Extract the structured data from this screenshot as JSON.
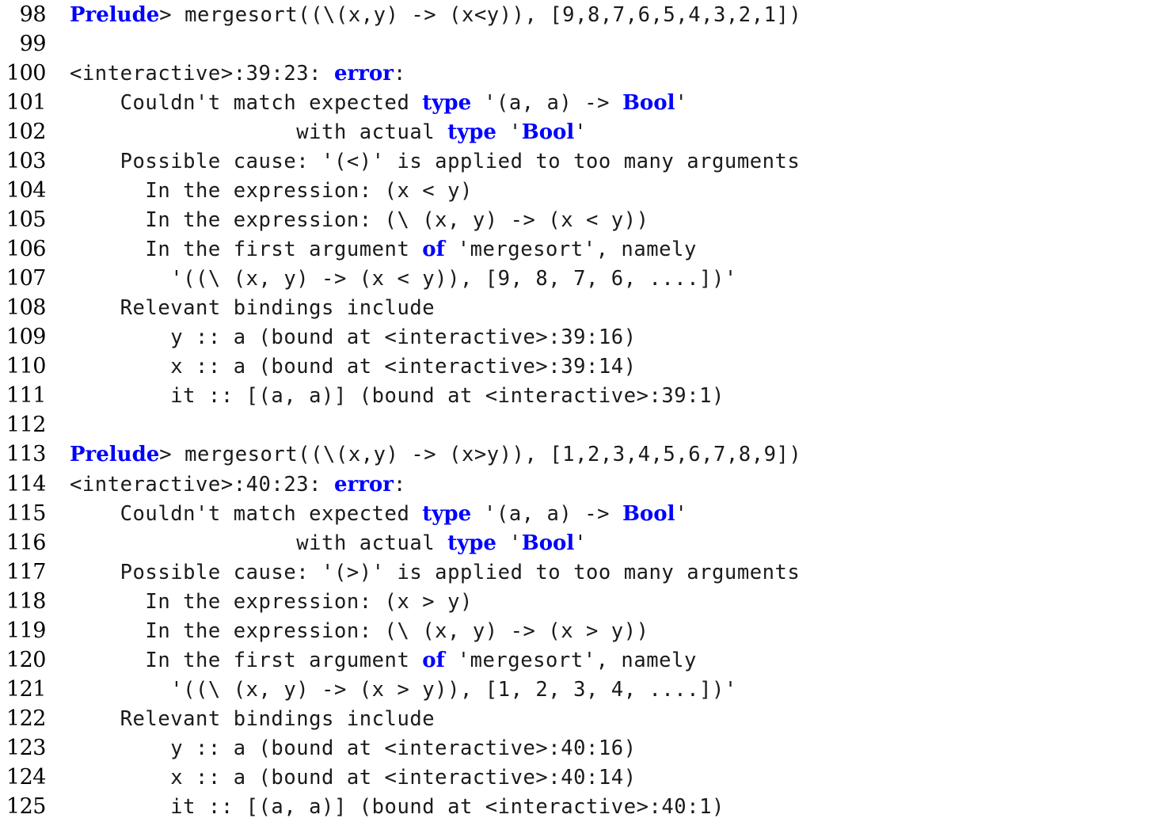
{
  "document": {
    "kind": "code-listing",
    "language": "Haskell GHCi session",
    "background_color": "#ffffff",
    "text_color": "#1a1a1a",
    "keyword_color": "#0000ff",
    "line_number_color": "#000000",
    "first_line_number": 98,
    "last_line_number": 125
  },
  "lines": [
    {
      "number": "98",
      "text": "Prelude> mergesort((\\(x,y) -> (x<y)), [9,8,7,6,5,4,3,2,1])",
      "tokens": [
        {
          "t": "Prelude",
          "kw": true
        },
        {
          "t": "> mergesort((\\(x,y) -> (x<y)), [9,8,7,6,5,4,3,2,1])",
          "kw": false
        }
      ]
    },
    {
      "number": "99",
      "text": "",
      "tokens": [
        {
          "t": "",
          "kw": false
        }
      ]
    },
    {
      "number": "100",
      "text": "<interactive>:39:23: error:",
      "tokens": [
        {
          "t": "<interactive>:39:23: ",
          "kw": false
        },
        {
          "t": "error",
          "kw": true
        },
        {
          "t": ":",
          "kw": false
        }
      ]
    },
    {
      "number": "101",
      "text": "    Couldn't match expected type '(a, a) -> Bool'",
      "tokens": [
        {
          "t": "    Couldn't match expected ",
          "kw": false
        },
        {
          "t": "type",
          "kw": true
        },
        {
          "t": " '(a, a) -> ",
          "kw": false
        },
        {
          "t": "Bool",
          "kw": true
        },
        {
          "t": "'",
          "kw": false
        }
      ]
    },
    {
      "number": "102",
      "text": "                  with actual type 'Bool'",
      "tokens": [
        {
          "t": "                  with actual ",
          "kw": false
        },
        {
          "t": "type",
          "kw": true
        },
        {
          "t": " '",
          "kw": false
        },
        {
          "t": "Bool",
          "kw": true
        },
        {
          "t": "'",
          "kw": false
        }
      ]
    },
    {
      "number": "103",
      "text": "    Possible cause: '(<)' is applied to too many arguments",
      "tokens": [
        {
          "t": "    Possible cause: '(<)' is applied to too many arguments",
          "kw": false
        }
      ]
    },
    {
      "number": "104",
      "text": "      In the expression: (x < y)",
      "tokens": [
        {
          "t": "      In the expression: (x < y)",
          "kw": false
        }
      ]
    },
    {
      "number": "105",
      "text": "      In the expression: (\\ (x, y) -> (x < y))",
      "tokens": [
        {
          "t": "      In the expression: (\\ (x, y) -> (x < y))",
          "kw": false
        }
      ]
    },
    {
      "number": "106",
      "text": "      In the first argument of 'mergesort', namely",
      "tokens": [
        {
          "t": "      In the first argument ",
          "kw": false
        },
        {
          "t": "of",
          "kw": true
        },
        {
          "t": " 'mergesort', namely",
          "kw": false
        }
      ]
    },
    {
      "number": "107",
      "text": "        '((\\ (x, y) -> (x < y)), [9, 8, 7, 6, ....])'",
      "tokens": [
        {
          "t": "        '((\\ (x, y) -> (x < y)), [9, 8, 7, 6, ....])'",
          "kw": false
        }
      ]
    },
    {
      "number": "108",
      "text": "    Relevant bindings include",
      "tokens": [
        {
          "t": "    Relevant bindings include",
          "kw": false
        }
      ]
    },
    {
      "number": "109",
      "text": "        y :: a (bound at <interactive>:39:16)",
      "tokens": [
        {
          "t": "        y :: a (bound at <interactive>:39:16)",
          "kw": false
        }
      ]
    },
    {
      "number": "110",
      "text": "        x :: a (bound at <interactive>:39:14)",
      "tokens": [
        {
          "t": "        x :: a (bound at <interactive>:39:14)",
          "kw": false
        }
      ]
    },
    {
      "number": "111",
      "text": "        it :: [(a, a)] (bound at <interactive>:39:1)",
      "tokens": [
        {
          "t": "        it :: [(a, a)] (bound at <interactive>:39:1)",
          "kw": false
        }
      ]
    },
    {
      "number": "112",
      "text": "",
      "tokens": [
        {
          "t": "",
          "kw": false
        }
      ]
    },
    {
      "number": "113",
      "text": "Prelude> mergesort((\\(x,y) -> (x>y)), [1,2,3,4,5,6,7,8,9])",
      "tokens": [
        {
          "t": "Prelude",
          "kw": true
        },
        {
          "t": "> mergesort((\\(x,y) -> (x>y)), [1,2,3,4,5,6,7,8,9])",
          "kw": false
        }
      ]
    },
    {
      "number": "114",
      "text": "<interactive>:40:23: error:",
      "tokens": [
        {
          "t": "<interactive>:40:23: ",
          "kw": false
        },
        {
          "t": "error",
          "kw": true
        },
        {
          "t": ":",
          "kw": false
        }
      ]
    },
    {
      "number": "115",
      "text": "    Couldn't match expected type '(a, a) -> Bool'",
      "tokens": [
        {
          "t": "    Couldn't match expected ",
          "kw": false
        },
        {
          "t": "type",
          "kw": true
        },
        {
          "t": " '(a, a) -> ",
          "kw": false
        },
        {
          "t": "Bool",
          "kw": true
        },
        {
          "t": "'",
          "kw": false
        }
      ]
    },
    {
      "number": "116",
      "text": "                  with actual type 'Bool'",
      "tokens": [
        {
          "t": "                  with actual ",
          "kw": false
        },
        {
          "t": "type",
          "kw": true
        },
        {
          "t": " '",
          "kw": false
        },
        {
          "t": "Bool",
          "kw": true
        },
        {
          "t": "'",
          "kw": false
        }
      ]
    },
    {
      "number": "117",
      "text": "    Possible cause: '(>)' is applied to too many arguments",
      "tokens": [
        {
          "t": "    Possible cause: '(>)' is applied to too many arguments",
          "kw": false
        }
      ]
    },
    {
      "number": "118",
      "text": "      In the expression: (x > y)",
      "tokens": [
        {
          "t": "      In the expression: (x > y)",
          "kw": false
        }
      ]
    },
    {
      "number": "119",
      "text": "      In the expression: (\\ (x, y) -> (x > y))",
      "tokens": [
        {
          "t": "      In the expression: (\\ (x, y) -> (x > y))",
          "kw": false
        }
      ]
    },
    {
      "number": "120",
      "text": "      In the first argument of 'mergesort', namely",
      "tokens": [
        {
          "t": "      In the first argument ",
          "kw": false
        },
        {
          "t": "of",
          "kw": true
        },
        {
          "t": " 'mergesort', namely",
          "kw": false
        }
      ]
    },
    {
      "number": "121",
      "text": "        '((\\ (x, y) -> (x > y)), [1, 2, 3, 4, ....])'",
      "tokens": [
        {
          "t": "        '((\\ (x, y) -> (x > y)), [1, 2, 3, 4, ....])'",
          "kw": false
        }
      ]
    },
    {
      "number": "122",
      "text": "    Relevant bindings include",
      "tokens": [
        {
          "t": "    Relevant bindings include",
          "kw": false
        }
      ]
    },
    {
      "number": "123",
      "text": "        y :: a (bound at <interactive>:40:16)",
      "tokens": [
        {
          "t": "        y :: a (bound at <interactive>:40:16)",
          "kw": false
        }
      ]
    },
    {
      "number": "124",
      "text": "        x :: a (bound at <interactive>:40:14)",
      "tokens": [
        {
          "t": "        x :: a (bound at <interactive>:40:14)",
          "kw": false
        }
      ]
    },
    {
      "number": "125",
      "text": "        it :: [(a, a)] (bound at <interactive>:40:1)",
      "tokens": [
        {
          "t": "        it :: [(a, a)] (bound at <interactive>:40:1)",
          "kw": false
        }
      ]
    }
  ]
}
